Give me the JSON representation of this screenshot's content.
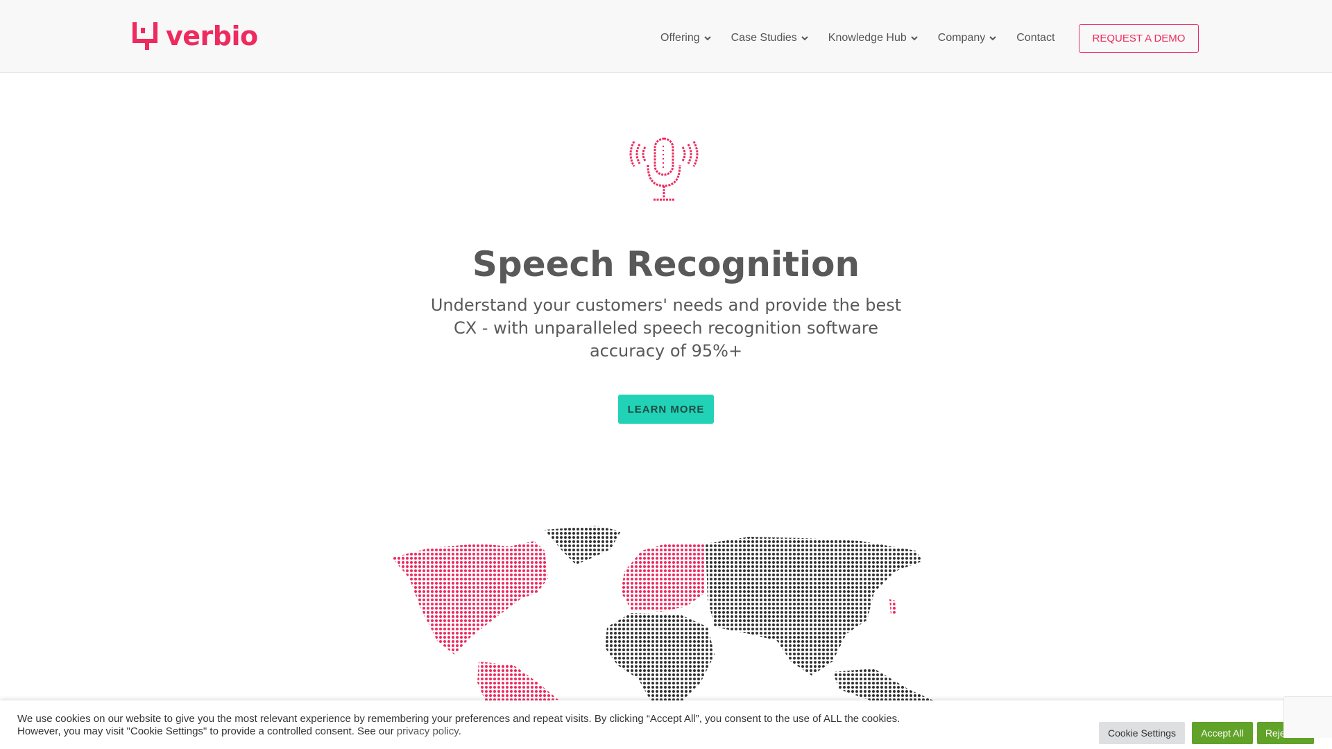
{
  "brand": {
    "name": "verbio",
    "color": "#ee2a5f"
  },
  "nav": {
    "items": [
      {
        "label": "Offering",
        "has_dropdown": true
      },
      {
        "label": "Case Studies",
        "has_dropdown": true
      },
      {
        "label": "Knowledge Hub",
        "has_dropdown": true
      },
      {
        "label": "Company",
        "has_dropdown": true
      },
      {
        "label": "Contact",
        "has_dropdown": false
      }
    ],
    "demo_label": "REQUEST A DEMO"
  },
  "hero": {
    "icon": "microphone-icon",
    "title": "Speech Recognition",
    "subtitle": "Understand your customers' needs and provide the best CX - with unparalleled speech recognition software accuracy of 95%+",
    "cta_label": "LEARN MORE",
    "cta_color": "#22d2b6"
  },
  "map": {
    "highlight_color": "#ee2a5f",
    "base_color": "#333333"
  },
  "cookie": {
    "text": "We use cookies on our website to give you the most relevant experience by remembering your preferences and repeat visits. By clicking “Accept All”, you consent to the use of ALL the cookies. However, you may visit \"Cookie Settings\" to provide a controlled consent. See our ",
    "link_label": "privacy policy",
    "text_end": ".",
    "settings_label": "Cookie Settings",
    "accept_label": "Accept All",
    "reject_label": "Reject All",
    "accept_color": "#61a229"
  }
}
